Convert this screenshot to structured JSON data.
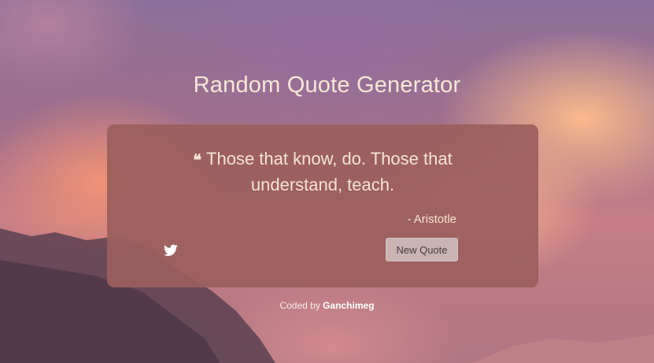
{
  "app": {
    "title": "Random Quote Generator"
  },
  "quote": {
    "icon": "quote-left-icon",
    "text": "Those that know, do. Those that understand, teach.",
    "author": "- Aristotle"
  },
  "actions": {
    "tweet_icon": "twitter-icon",
    "new_quote_label": "New Quote"
  },
  "footer": {
    "prefix": "Coded by",
    "author": "Ganchimeg"
  },
  "colors": {
    "card_background": "#9b5f5c",
    "text": "#f6e4d0",
    "button_background": "#c9b3b3"
  }
}
